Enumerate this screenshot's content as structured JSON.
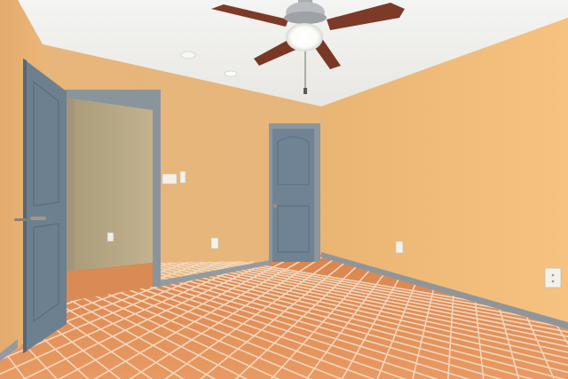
{
  "scene": {
    "kind": "photo",
    "subject": "empty-bedroom",
    "colors": {
      "ceiling": "#f2f1ee",
      "wall_left": "#e9b476",
      "wall_back": "#e7b678",
      "wall_right": "#f2bc7c",
      "baseboard": "#8f969b",
      "door": "#6f8394",
      "door_frame": "#8a949b",
      "closet_wall": "#b9a886",
      "closet_floor": "#d98a55",
      "tile": "#df8a52",
      "tile_dark": "#cf7440",
      "grout": "#f1d7bd",
      "fan_blade": "#7d3a26",
      "fan_body": "#b9bcc0",
      "fan_light": "#ffffff",
      "outlet": "#f3f1ea"
    }
  }
}
